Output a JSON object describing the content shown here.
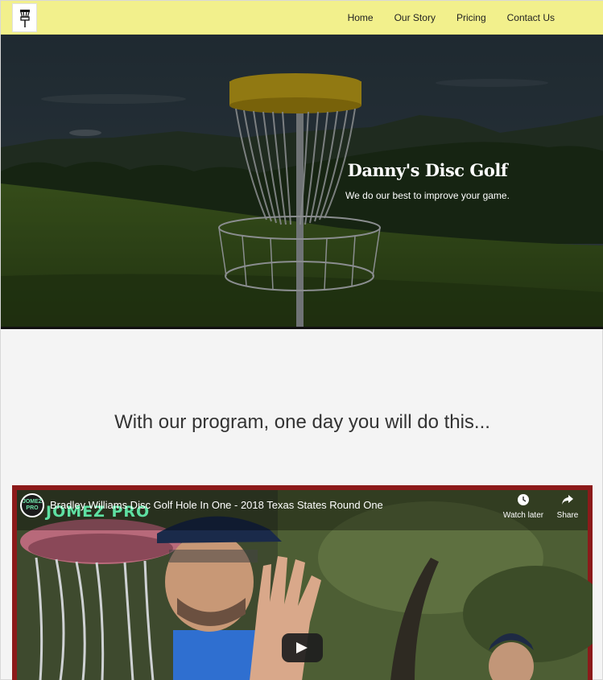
{
  "nav": {
    "logo_icon": "disc-golf-basket-icon",
    "links": [
      "Home",
      "Our Story",
      "Pricing",
      "Contact Us"
    ]
  },
  "hero": {
    "title": "Danny's Disc Golf",
    "subtitle": "We do our best to improve your game."
  },
  "section": {
    "heading": "With our program, one day you will do this..."
  },
  "video": {
    "channel_icon_text": "JOMEZ PRO",
    "title": "Bradley Williams Disc Golf Hole In One - 2018 Texas States Round One",
    "watch_later_label": "Watch later",
    "share_label": "Share",
    "watermark": "JOMEZ PRO",
    "play_icon": "play-icon"
  },
  "colors": {
    "nav_background": "#f2f08c",
    "page_background": "#f4f4f4",
    "video_border": "#8c1a1a"
  }
}
